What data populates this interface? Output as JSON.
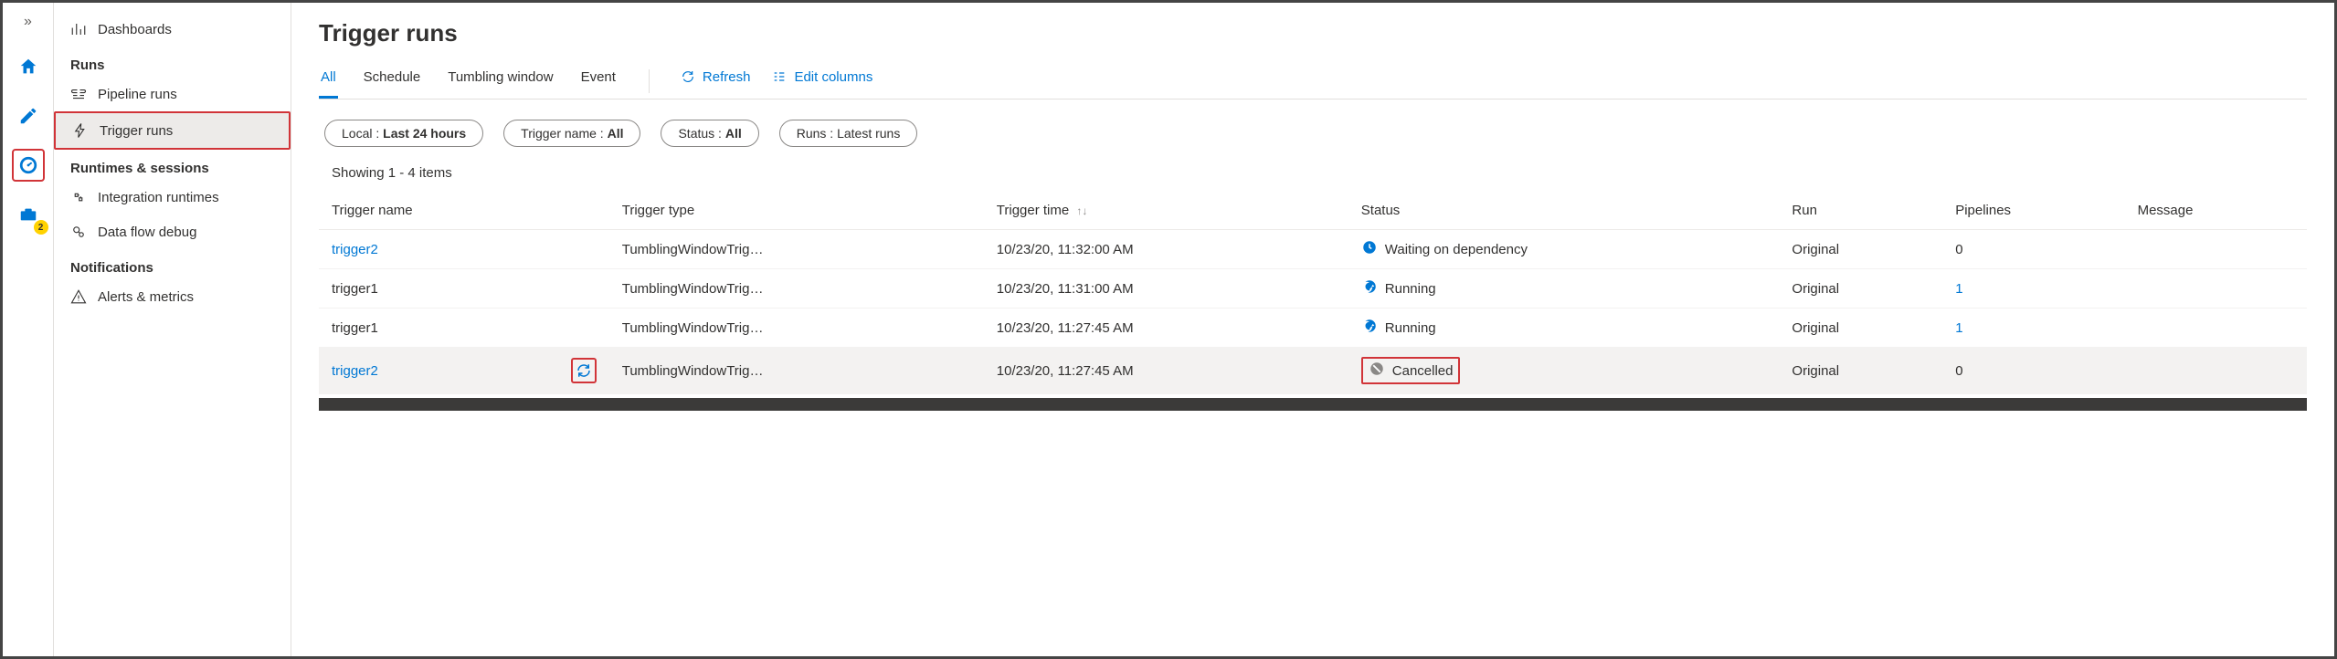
{
  "rail": {
    "badge": "2"
  },
  "sidebar": {
    "dashboards": "Dashboards",
    "group_runs": "Runs",
    "pipeline_runs": "Pipeline runs",
    "trigger_runs": "Trigger runs",
    "group_runtimes": "Runtimes & sessions",
    "integration_runtimes": "Integration runtimes",
    "data_flow_debug": "Data flow debug",
    "group_notifications": "Notifications",
    "alerts_metrics": "Alerts & metrics"
  },
  "page": {
    "title": "Trigger runs",
    "tabs": {
      "all": "All",
      "schedule": "Schedule",
      "tumbling": "Tumbling window",
      "event": "Event"
    },
    "actions": {
      "refresh": "Refresh",
      "edit_columns": "Edit columns"
    },
    "filters": {
      "local_label": "Local :",
      "local_value": "Last 24 hours",
      "trigger_label": "Trigger name :",
      "trigger_value": "All",
      "status_label": "Status :",
      "status_value": "All",
      "runs_label": "Runs :",
      "runs_value": "Latest runs"
    },
    "showing": "Showing 1 - 4 items",
    "columns": {
      "trigger_name": "Trigger name",
      "trigger_type": "Trigger type",
      "trigger_time": "Trigger time",
      "status": "Status",
      "run": "Run",
      "pipelines": "Pipelines",
      "message": "Message"
    },
    "rows": [
      {
        "name": "trigger2",
        "name_link": true,
        "type": "TumblingWindowTrig…",
        "time": "10/23/20, 11:32:00 AM",
        "status": "Waiting on dependency",
        "status_kind": "waiting",
        "run": "Original",
        "pipelines": "0",
        "pipelines_link": false
      },
      {
        "name": "trigger1",
        "name_link": false,
        "type": "TumblingWindowTrig…",
        "time": "10/23/20, 11:31:00 AM",
        "status": "Running",
        "status_kind": "running",
        "run": "Original",
        "pipelines": "1",
        "pipelines_link": true
      },
      {
        "name": "trigger1",
        "name_link": false,
        "type": "TumblingWindowTrig…",
        "time": "10/23/20, 11:27:45 AM",
        "status": "Running",
        "status_kind": "running",
        "run": "Original",
        "pipelines": "1",
        "pipelines_link": true
      },
      {
        "name": "trigger2",
        "name_link": true,
        "type": "TumblingWindowTrig…",
        "time": "10/23/20, 11:27:45 AM",
        "status": "Cancelled",
        "status_kind": "cancelled",
        "run": "Original",
        "pipelines": "0",
        "pipelines_link": false
      }
    ]
  }
}
